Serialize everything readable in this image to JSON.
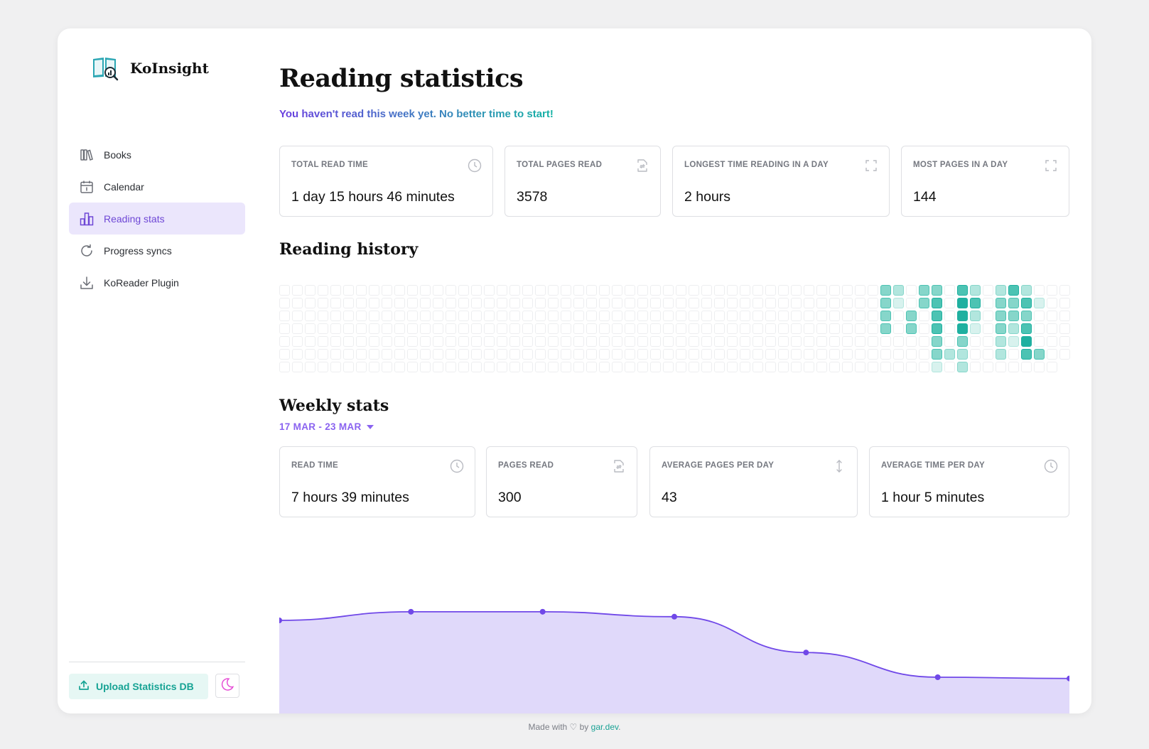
{
  "app": {
    "name": "KoInsight"
  },
  "sidebar": {
    "items": [
      {
        "label": "Books",
        "icon": "books-icon",
        "active": false
      },
      {
        "label": "Calendar",
        "icon": "calendar-icon",
        "active": false
      },
      {
        "label": "Reading stats",
        "icon": "bar-chart-icon",
        "active": true
      },
      {
        "label": "Progress syncs",
        "icon": "refresh-icon",
        "active": false
      },
      {
        "label": "KoReader Plugin",
        "icon": "download-icon",
        "active": false
      }
    ],
    "upload_label": "Upload Statistics DB",
    "theme_icon": "moon-icon"
  },
  "page": {
    "title": "Reading statistics",
    "subtitle": "You haven't read this week yet. No better time to start!"
  },
  "overall_stats": [
    {
      "label": "TOTAL READ TIME",
      "value": "1 day 15 hours 46 minutes",
      "icon": "clock-icon"
    },
    {
      "label": "TOTAL PAGES READ",
      "value": "3578",
      "icon": "file-sync-icon"
    },
    {
      "label": "LONGEST TIME READING IN A DAY",
      "value": "2 hours",
      "icon": "maximize-icon"
    },
    {
      "label": "MOST PAGES IN A DAY",
      "value": "144",
      "icon": "maximize-icon"
    }
  ],
  "reading_history": {
    "title": "Reading history",
    "weeks": 62,
    "days_per_week": 7,
    "last_week_days": 6,
    "levels": [
      [
        47,
        0,
        3
      ],
      [
        47,
        1,
        3
      ],
      [
        47,
        2,
        3
      ],
      [
        47,
        3,
        3
      ],
      [
        48,
        0,
        2
      ],
      [
        48,
        1,
        1
      ],
      [
        49,
        2,
        3
      ],
      [
        49,
        3,
        3
      ],
      [
        50,
        0,
        3
      ],
      [
        50,
        1,
        3
      ],
      [
        51,
        0,
        3
      ],
      [
        51,
        1,
        4
      ],
      [
        51,
        2,
        4
      ],
      [
        51,
        3,
        4
      ],
      [
        51,
        4,
        3
      ],
      [
        51,
        5,
        3
      ],
      [
        51,
        6,
        1
      ],
      [
        52,
        5,
        2
      ],
      [
        53,
        0,
        4
      ],
      [
        53,
        1,
        5
      ],
      [
        53,
        2,
        5
      ],
      [
        53,
        3,
        5
      ],
      [
        53,
        4,
        3
      ],
      [
        53,
        5,
        2
      ],
      [
        53,
        6,
        2
      ],
      [
        54,
        0,
        2
      ],
      [
        54,
        1,
        4
      ],
      [
        54,
        2,
        2
      ],
      [
        54,
        3,
        1
      ],
      [
        56,
        0,
        2
      ],
      [
        56,
        1,
        3
      ],
      [
        56,
        2,
        3
      ],
      [
        56,
        3,
        3
      ],
      [
        56,
        4,
        2
      ],
      [
        56,
        5,
        2
      ],
      [
        57,
        0,
        4
      ],
      [
        57,
        1,
        3
      ],
      [
        57,
        2,
        3
      ],
      [
        57,
        3,
        2
      ],
      [
        57,
        4,
        1
      ],
      [
        58,
        0,
        2
      ],
      [
        58,
        1,
        4
      ],
      [
        58,
        2,
        3
      ],
      [
        58,
        3,
        4
      ],
      [
        58,
        4,
        5
      ],
      [
        58,
        5,
        4
      ],
      [
        59,
        1,
        1
      ],
      [
        59,
        5,
        3
      ]
    ],
    "colors": [
      "#ffffff",
      "#d8f2ee",
      "#b2e6de",
      "#86d6ca",
      "#4cc3b3",
      "#1fb0a0"
    ]
  },
  "weekly": {
    "title": "Weekly stats",
    "range_label": "17 MAR - 23 MAR",
    "stats": [
      {
        "label": "READ TIME",
        "value": "7 hours 39 minutes",
        "icon": "clock-icon"
      },
      {
        "label": "PAGES READ",
        "value": "300",
        "icon": "file-sync-icon"
      },
      {
        "label": "AVERAGE PAGES PER DAY",
        "value": "43",
        "icon": "arrows-vertical-icon"
      },
      {
        "label": "AVERAGE TIME PER DAY",
        "value": "1 hour 5 minutes",
        "icon": "clock-icon"
      }
    ]
  },
  "chart_data": {
    "type": "area",
    "x": [
      1,
      2,
      3,
      4,
      5,
      6,
      7
    ],
    "values": [
      88,
      95,
      95,
      91,
      62,
      42,
      41
    ],
    "ylim": [
      0,
      130
    ],
    "color": "#7048e8",
    "fill": "#e0d9fa"
  },
  "footer": {
    "prefix": "Made with ♡ by ",
    "link": "gar.dev",
    "suffix": "."
  }
}
